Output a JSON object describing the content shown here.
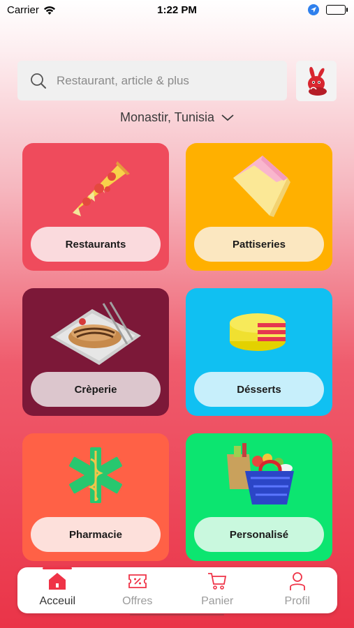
{
  "status": {
    "carrier": "Carrier",
    "time": "1:22 PM"
  },
  "search": {
    "placeholder": "Restaurant, article & plus",
    "value": ""
  },
  "location": {
    "label": "Monastir, Tunisia"
  },
  "categories": [
    {
      "label": "Restaurants",
      "color": "#ef4b5c",
      "pill": "#fadadd",
      "icon": "pizza-icon"
    },
    {
      "label": "Pattiseries",
      "color": "#ffb000",
      "pill": "#fbe7c0",
      "icon": "cake-slice-icon"
    },
    {
      "label": "Crèperie",
      "color": "#7c1838",
      "pill": "#dcc6cd",
      "icon": "crepe-plate-icon"
    },
    {
      "label": "Désserts",
      "color": "#10c0f2",
      "pill": "#c7effb",
      "icon": "cheese-cake-icon"
    },
    {
      "label": "Pharmacie",
      "color": "#ff6146",
      "pill": "#fde0db",
      "icon": "pharmacy-caduceus-icon"
    },
    {
      "label": "Personalisé",
      "color": "#0ce570",
      "pill": "#c9f8de",
      "icon": "grocery-basket-icon"
    }
  ],
  "tabs": [
    {
      "label": "Acceuil",
      "icon": "home-icon",
      "active": true
    },
    {
      "label": "Offres",
      "icon": "offers-icon",
      "active": false
    },
    {
      "label": "Panier",
      "icon": "cart-icon",
      "active": false
    },
    {
      "label": "Profil",
      "icon": "profile-icon",
      "active": false
    }
  ],
  "accent": "#ef3347"
}
